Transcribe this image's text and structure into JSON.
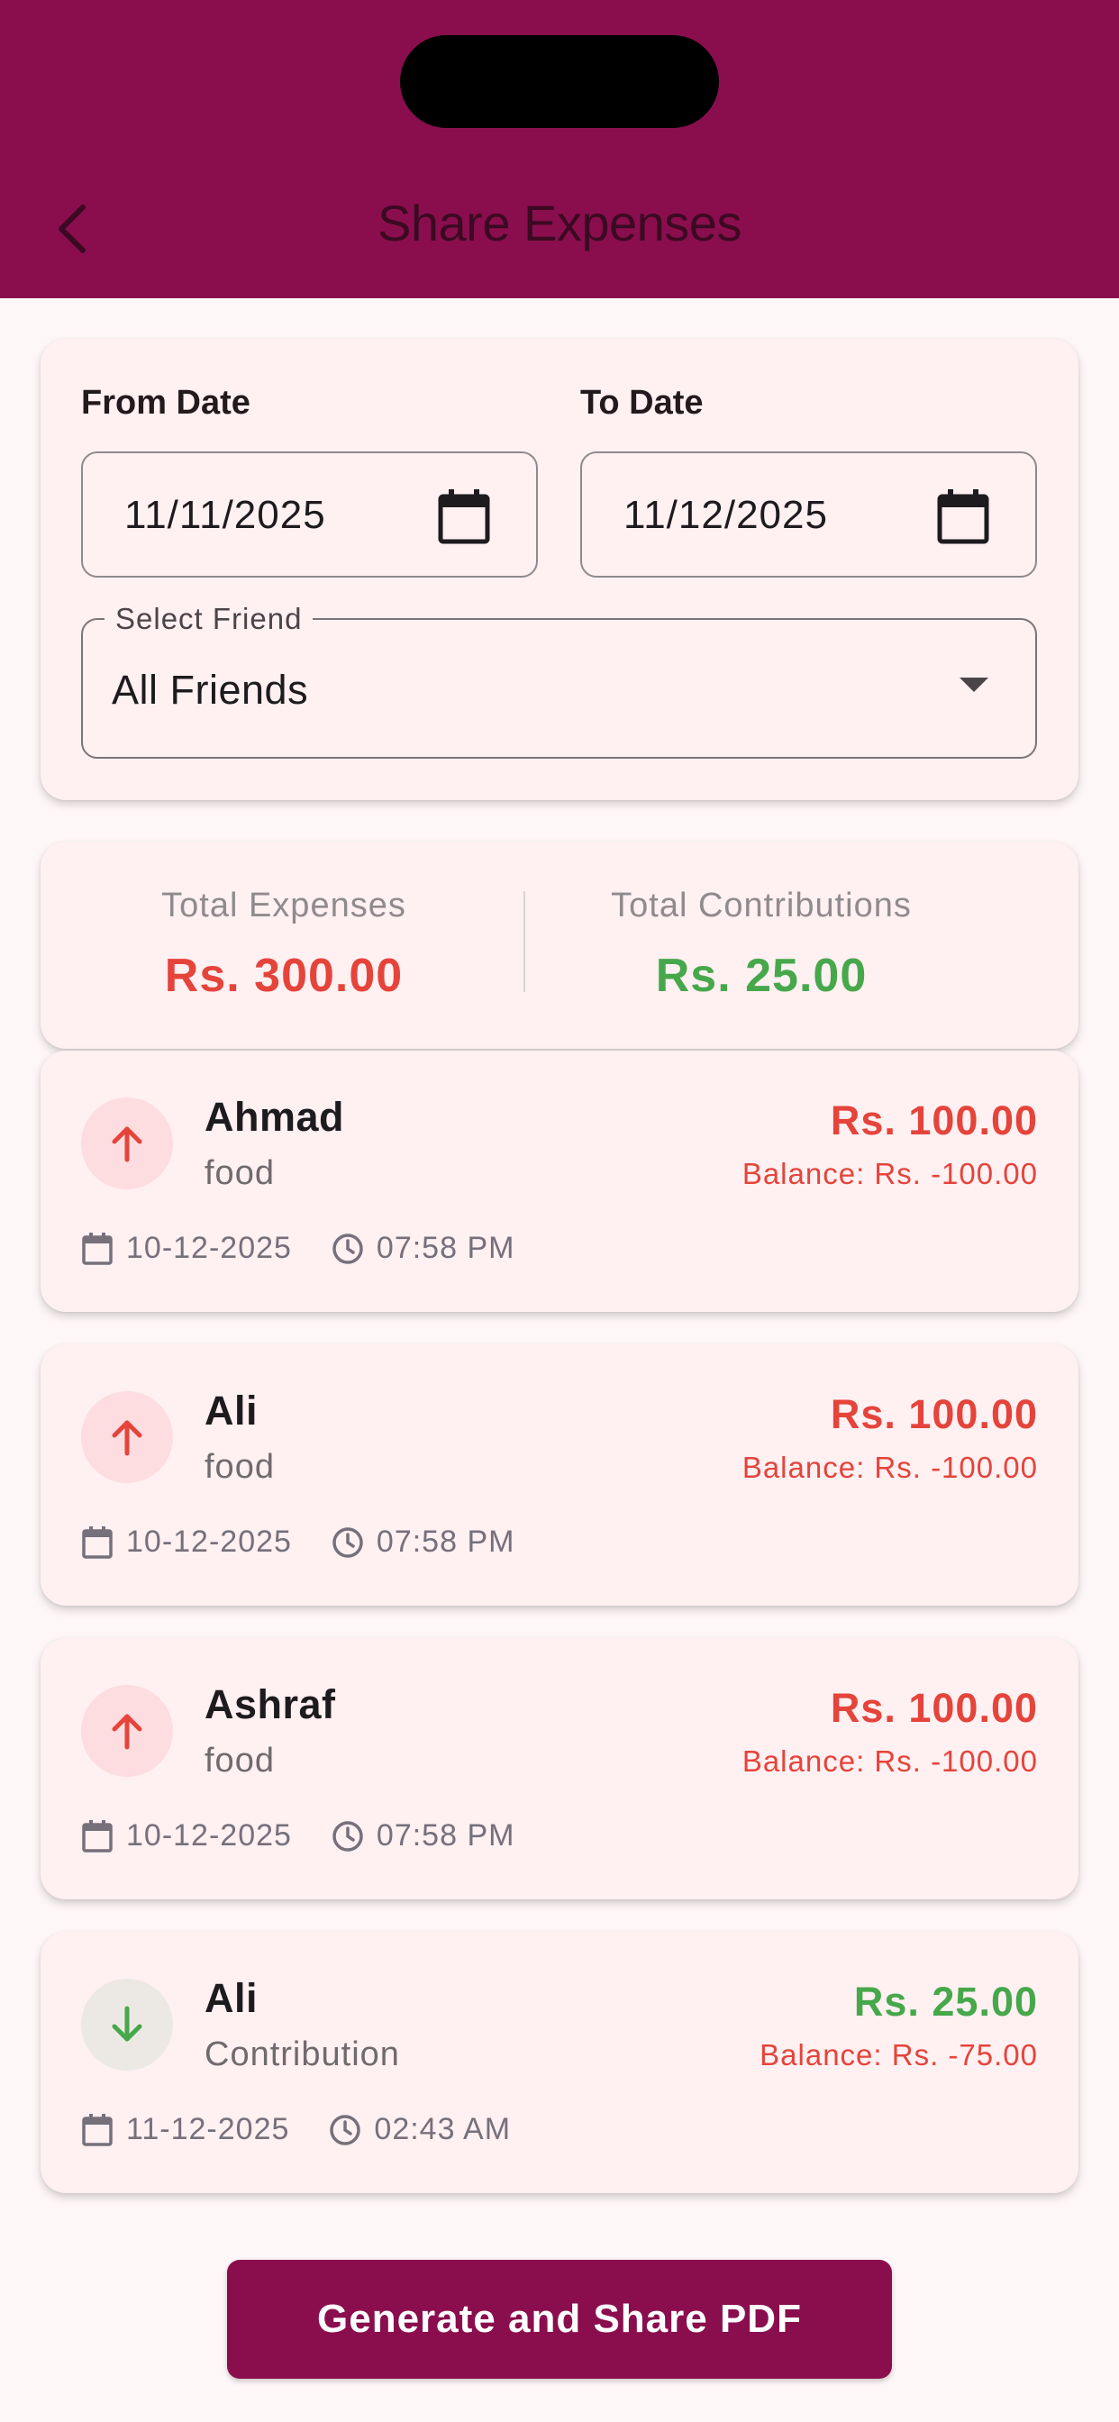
{
  "header": {
    "title": "Share Expenses",
    "back_icon": "chevron-left-icon"
  },
  "filters": {
    "from_label": "From Date",
    "from_value": "11/11/2025",
    "to_label": "To Date",
    "to_value": "11/12/2025",
    "friend_label": "Select Friend",
    "friend_value": "All Friends"
  },
  "totals": {
    "expenses_label": "Total Expenses",
    "expenses_value": "Rs. 300.00",
    "contributions_label": "Total Contributions",
    "contributions_value": "Rs. 25.00"
  },
  "transactions": [
    {
      "name": "Ahmad",
      "category": "food",
      "amount": "Rs. 100.00",
      "balance": "Balance: Rs. -100.00",
      "date": "10-12-2025",
      "time": "07:58 PM",
      "direction": "up"
    },
    {
      "name": "Ali",
      "category": "food",
      "amount": "Rs. 100.00",
      "balance": "Balance: Rs. -100.00",
      "date": "10-12-2025",
      "time": "07:58 PM",
      "direction": "up"
    },
    {
      "name": "Ashraf",
      "category": "food",
      "amount": "Rs. 100.00",
      "balance": "Balance: Rs. -100.00",
      "date": "10-12-2025",
      "time": "07:58 PM",
      "direction": "up"
    },
    {
      "name": "Ali",
      "category": "Contribution",
      "amount": "Rs. 25.00",
      "balance": "Balance: Rs. -75.00",
      "date": "11-12-2025",
      "time": "02:43 AM",
      "direction": "down"
    }
  ],
  "actions": {
    "generate_label": "Generate and Share PDF"
  },
  "colors": {
    "primary": "#8a0e4e",
    "expense": "#e5443b",
    "contribution": "#46a84b",
    "card_bg": "#fff0f2"
  }
}
